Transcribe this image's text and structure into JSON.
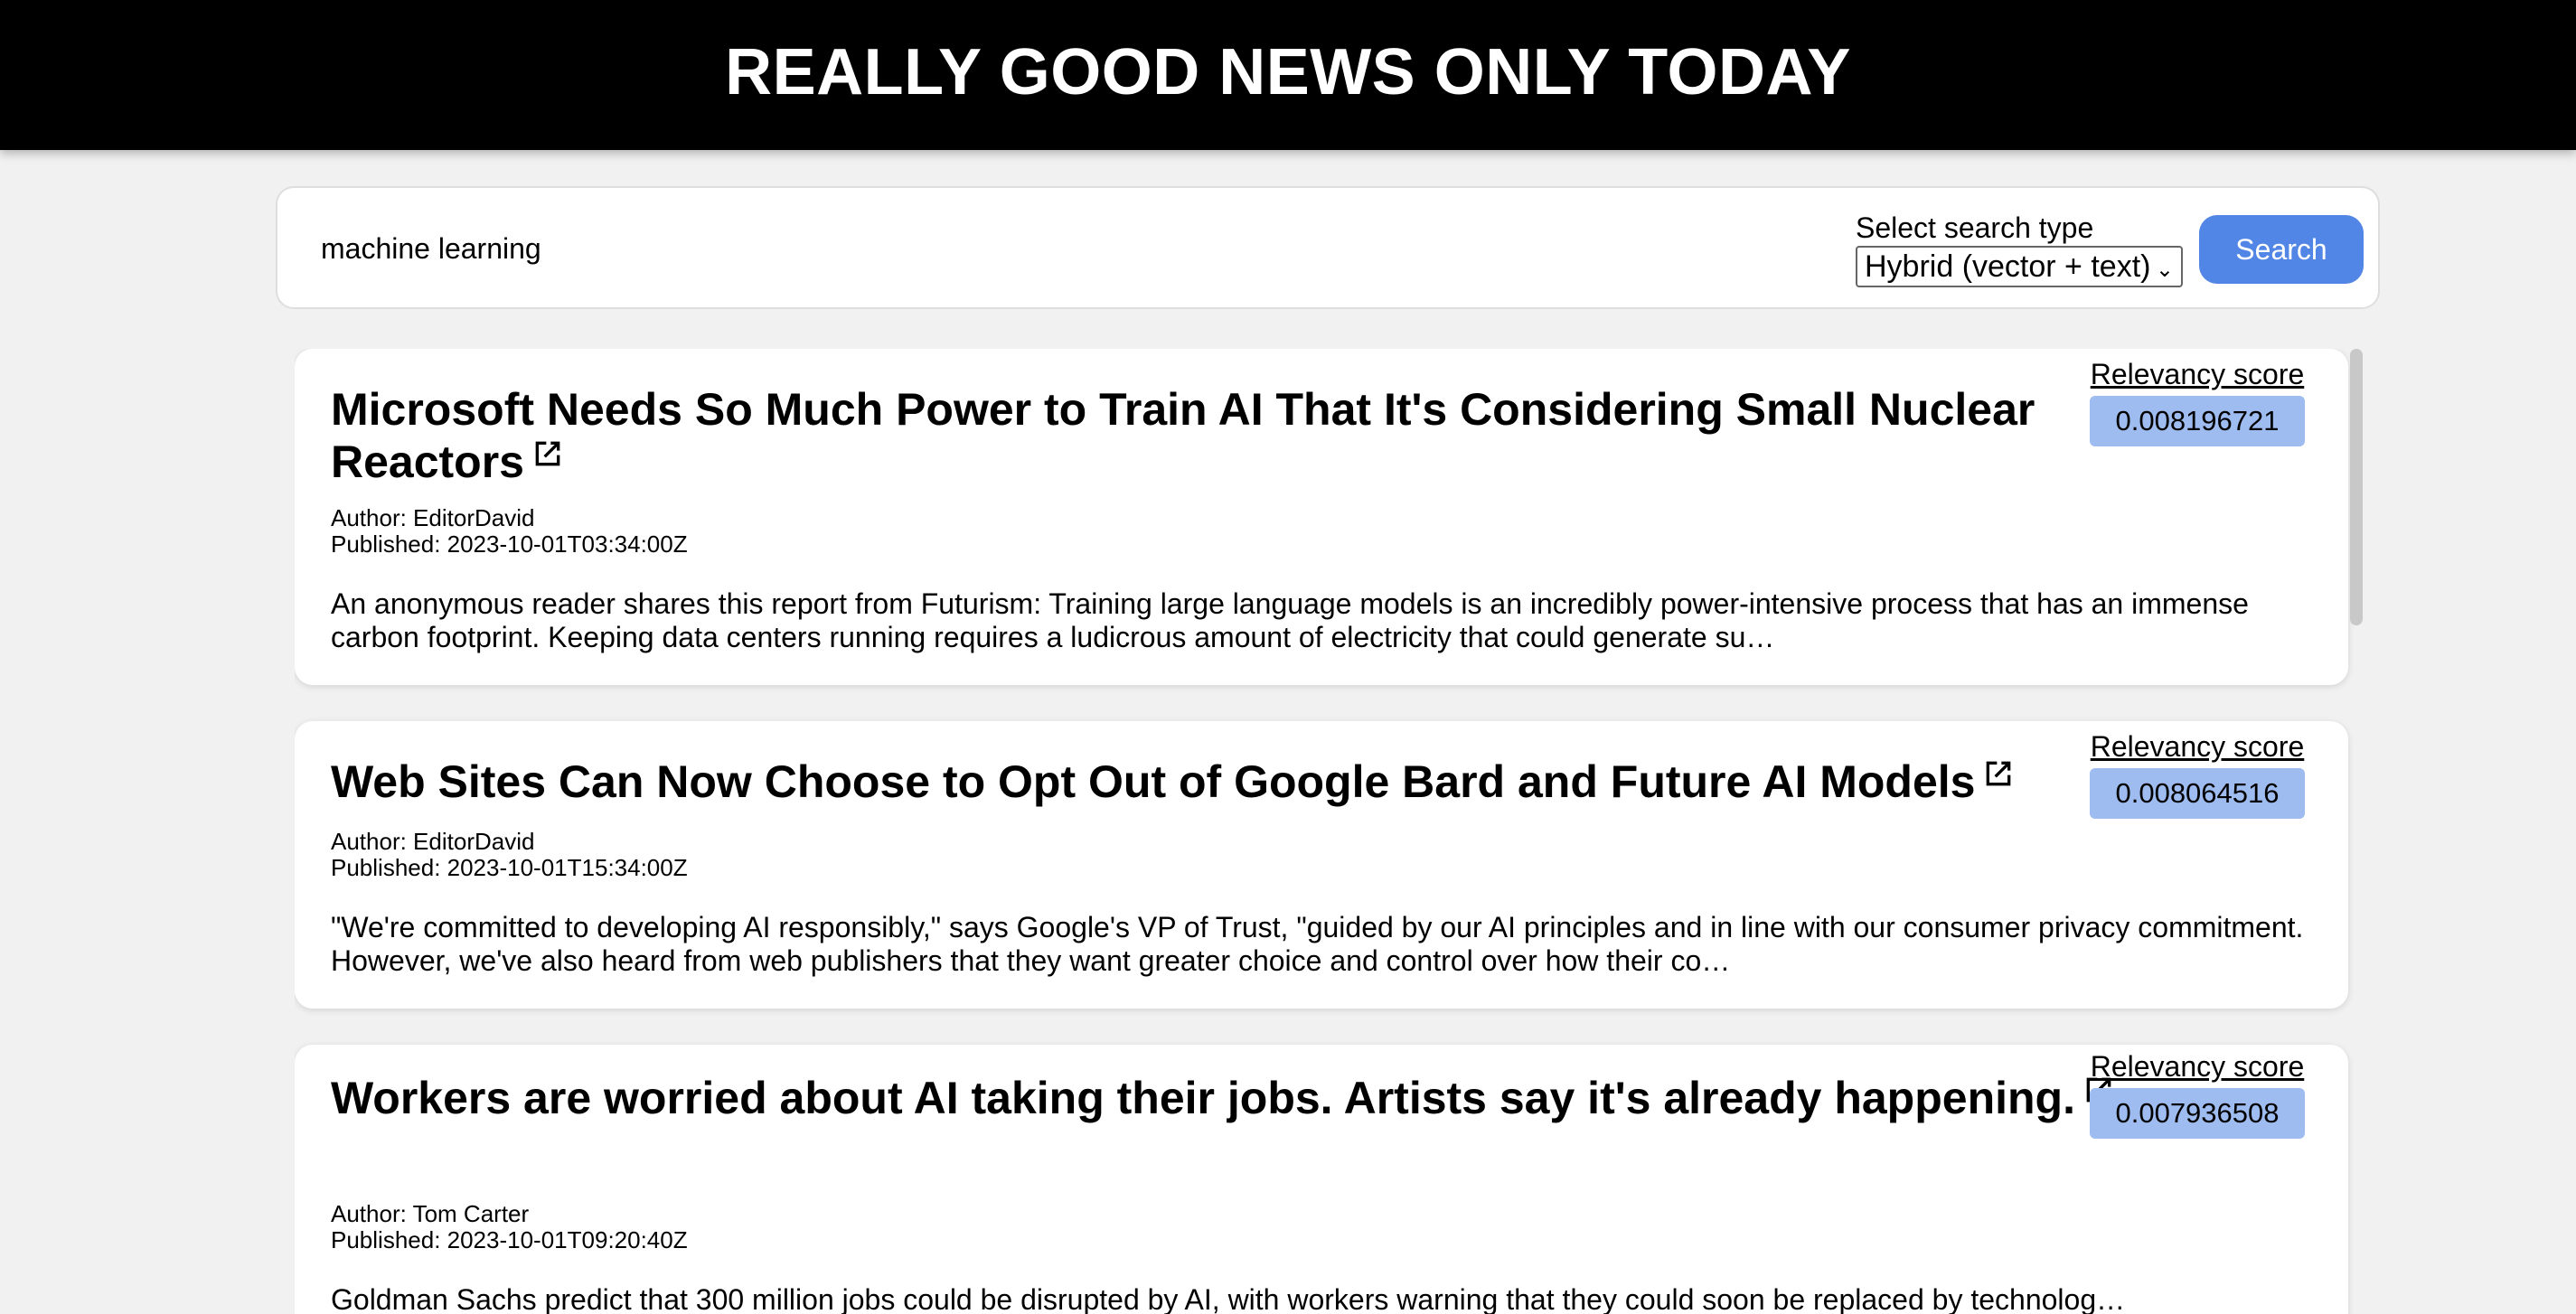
{
  "header": {
    "title": "REALLY GOOD NEWS ONLY TODAY"
  },
  "search": {
    "query": "machine learning",
    "type_label": "Select search type",
    "type_selected": "Hybrid (vector + text)",
    "button_label": "Search"
  },
  "results": [
    {
      "title": "Microsoft Needs So Much Power to Train AI That It's Considering Small Nuclear Reactors",
      "author": "Author: EditorDavid",
      "published": "Published: 2023-10-01T03:34:00Z",
      "summary": "An anonymous reader shares this report from Futurism: Training large language models is an incredibly power-intensive process that has an immense carbon footprint. Keeping data centers running requires a ludicrous amount of electricity that could generate su…",
      "score_label": "Relevancy score",
      "score": "0.008196721"
    },
    {
      "title": "Web Sites Can Now Choose to Opt Out of Google Bard and Future AI Models",
      "author": "Author: EditorDavid",
      "published": "Published: 2023-10-01T15:34:00Z",
      "summary": "\"We're committed to developing AI responsibly,\" says Google's VP of Trust, \"guided by our AI principles and in line with our consumer privacy commitment. However, we've also heard from web publishers that they want greater choice and control over how their co…",
      "score_label": "Relevancy score",
      "score": "0.008064516"
    },
    {
      "title": "Workers are worried about AI taking their jobs. Artists say it's already happening.",
      "author": "Author: Tom Carter",
      "published": "Published: 2023-10-01T09:20:40Z",
      "summary": "Goldman Sachs predict that 300 million jobs could be disrupted by AI, with workers warning that they could soon be replaced by technolog…",
      "score_label": "Relevancy score",
      "score": "0.007936508"
    }
  ],
  "icons": {
    "title_link": "external-link-icon"
  },
  "colors": {
    "header_bg": "#000000",
    "search_button": "#5286e6",
    "score_badge": "#9fbcf0",
    "page_bg": "#f1f1f1"
  }
}
